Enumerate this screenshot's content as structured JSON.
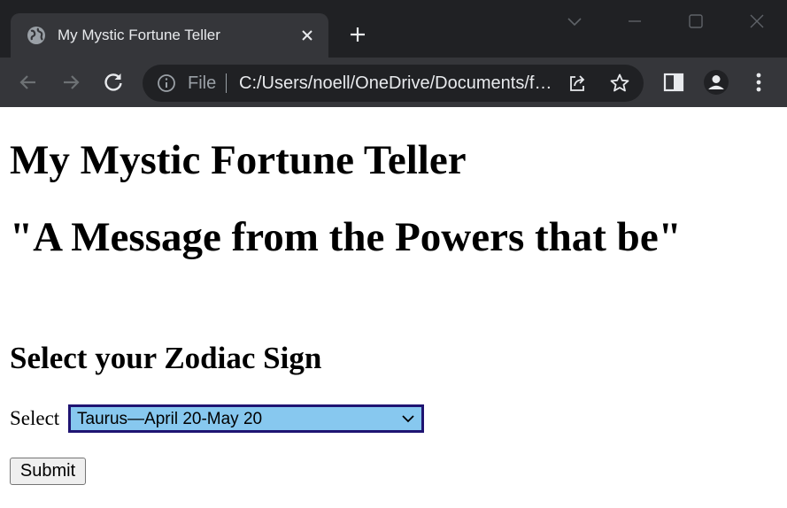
{
  "browser": {
    "tab": {
      "title": "My Mystic Fortune Teller"
    },
    "address_bar": {
      "scheme_label": "File",
      "url": "C:/Users/noell/OneDrive/Documents/fortune.html"
    }
  },
  "page": {
    "heading": "My Mystic Fortune Teller",
    "subheading": "\"A Message from the Powers that be\"",
    "zodiac_heading": "Select your Zodiac Sign",
    "select_label": "Select",
    "zodiac_select": {
      "selected": "Taurus—April 20-May 20"
    },
    "submit_label": "Submit"
  },
  "colors": {
    "select_background": "#87c8ef",
    "select_border": "#1f1472"
  }
}
